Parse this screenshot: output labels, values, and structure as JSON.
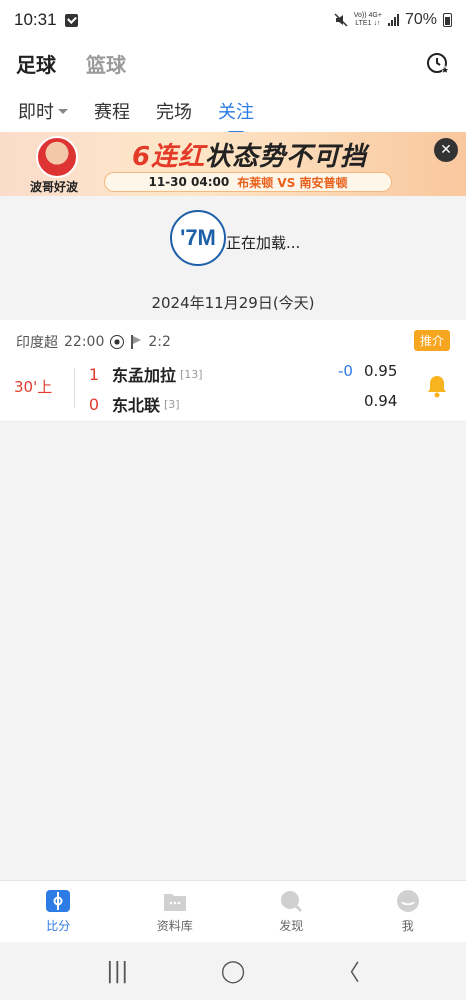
{
  "status_bar": {
    "time": "10:31",
    "network_top": "Vo)) 4G+",
    "network_bottom": "LTE1 ↓↑",
    "battery": "70%"
  },
  "header": {
    "tabs": [
      {
        "label": "足球",
        "active": true
      },
      {
        "label": "篮球",
        "active": false
      }
    ]
  },
  "sub_tabs": [
    {
      "label": "即时",
      "active": false,
      "has_dropdown": true
    },
    {
      "label": "赛程",
      "active": false
    },
    {
      "label": "完场",
      "active": false
    },
    {
      "label": "关注",
      "active": true
    }
  ],
  "banner": {
    "avatar_name": "波哥好波",
    "headline_red": "6连红",
    "headline_black": "状态势不可挡",
    "match_time": "11-30 04:00",
    "match_teams": "布莱顿 VS 南安普顿",
    "close": "✕"
  },
  "loading": {
    "logo_text": "'7M",
    "text": "正在加载..."
  },
  "date_line": "2024年11月29日(今天)",
  "match": {
    "league": "印度超",
    "kickoff": "22:00",
    "corners": "2:2",
    "tag": "推介",
    "minute": "30'上",
    "home": {
      "score": "1",
      "name": "东孟加拉",
      "rank": "[13]"
    },
    "away": {
      "score": "0",
      "name": "东北联",
      "rank": "[3]"
    },
    "handicap": "-0",
    "odds_home": "0.95",
    "odds_away": "0.94"
  },
  "bottom_nav": [
    {
      "label": "比分",
      "active": true,
      "icon": "score-icon"
    },
    {
      "label": "资料库",
      "active": false,
      "icon": "database-icon"
    },
    {
      "label": "发现",
      "active": false,
      "icon": "discover-icon"
    },
    {
      "label": "我",
      "active": false,
      "icon": "profile-icon"
    }
  ],
  "system_nav": {
    "recents": "|||",
    "home": "◯",
    "back": "〈"
  },
  "colors": {
    "accent": "#2d7be5",
    "live_red": "#e23b2f",
    "tag_orange": "#f8a51f"
  }
}
